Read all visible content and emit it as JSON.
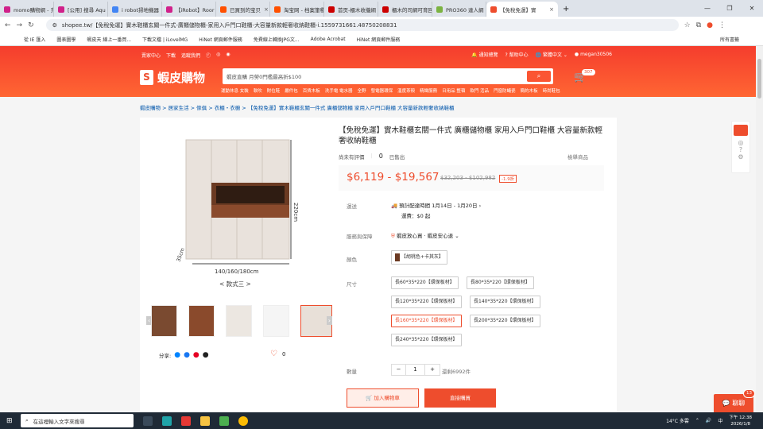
{
  "tabs": [
    {
      "label": "momo購物網 - 充",
      "color": "#d0218a"
    },
    {
      "label": "[公用] 搜尋 Aqu",
      "color": "#d0218a"
    },
    {
      "label": "i robot掃地機器",
      "color": "#4285f4"
    },
    {
      "label": "【iRobot】Roor",
      "color": "#d0218a"
    },
    {
      "label": "已買到的宝贝",
      "color": "#ff5000"
    },
    {
      "label": "淘宝网 - 档案筆種",
      "color": "#ff5000"
    },
    {
      "label": "首页-櫃木收攏網",
      "color": "#c00"
    },
    {
      "label": "櫃木的司網可育回",
      "color": "#c00"
    },
    {
      "label": "PRO360 達人網",
      "color": "#7cb342"
    }
  ],
  "active_tab": "【免稅免運】實",
  "window_controls": [
    "—",
    "❐",
    "✕"
  ],
  "url": "shopee.tw/【免稅免運】實木鞋櫃玄關一件式-廣櫃儲物櫃-家用入戶門口鞋櫃-大容量新款輕奢收納鞋櫃-i.1559731661.48750208831",
  "bookmarks": [
    "從 IE 匯入",
    "圖表圖學",
    "蝦皮天 線上一番買...",
    "下載文檔 | iLovelMG",
    "HiNet 網頁郵件服務",
    "免費線上轉換JPG文...",
    "Adobe Acrobat",
    "HiNet 網頁郵件服務"
  ],
  "bookmarks_all": "所有書籤",
  "shopee": {
    "toplinks": [
      "賣家中心",
      "下載",
      "追蹤我們"
    ],
    "notify": "通知總覽",
    "help": "幫助中心",
    "lang": "繁體中文",
    "user": "megan30506",
    "logo": "蝦皮購物",
    "search_placeholder": "蝦皮直購 月勞0門檻最高折$100",
    "cats": [
      "運動休息 女裝",
      "軟吹",
      "財位鞋",
      "嚴件包",
      "百貨木板",
      "洗手電 電水器",
      "全野",
      "發電器環保",
      "溫度茶殼",
      "精緻服務",
      "日用品 整頓",
      "軟門 活品",
      "門窗防蠅瓷",
      "簡約木板",
      "時尚鞋包"
    ],
    "cart_count": "307"
  },
  "breadcrumb": "蝦皮購物 > 居家生活 > 傢俱 > 衣櫃・衣櫥 > 【免稅免運】實木鞋櫃玄關一件式 廣櫃儲物櫃 家用入戶門口鞋櫃 大容量新款輕奢收納鞋櫃",
  "image": {
    "height_label": "220cm",
    "depth_label": "35cm",
    "width_label": "140/160/180cm",
    "caption": "< 款式三 >"
  },
  "share": {
    "label": "分享:",
    "likes": "0"
  },
  "product": {
    "title": "【免稅免運】實木鞋櫃玄關一件式 廣櫃儲物櫃 家用入戶門口鞋櫃 大容量新款輕奢收納鞋櫃",
    "rating": "尚未有評價",
    "sold_count": "0",
    "sold_label": "已售出",
    "report": "檢舉商品",
    "price": "$6,119 - $19,567",
    "old_price": "$32,203 - $102,982",
    "discount": "-1.9折"
  },
  "shipping": {
    "label": "運送",
    "eta": "預計配達時間 1月14日 - 1月20日",
    "fee": "運費：$0 起"
  },
  "guarantee": {
    "label": "服務與保障",
    "value": "蝦皮放心買 · 蝦皮安心退"
  },
  "color": {
    "label": "顏色",
    "value": "【胡桃色+卡其灰】"
  },
  "size": {
    "label": "尺寸",
    "options": [
      "長60*35*220【環保板材】",
      "長80*35*220【環保板材】",
      "長120*35*220【環保板材】",
      "長140*35*220【環保板材】",
      "長160*35*220【環保板材】",
      "長200*35*220【環保板材】",
      "長240*35*220【環保板材】"
    ],
    "selected": "長160*35*220【環保板材】"
  },
  "quantity": {
    "label": "數量",
    "value": "1",
    "stock": "還剩6992件"
  },
  "buttons": {
    "add_to_cart": "加入購物車",
    "buy_now": "直接購買"
  },
  "chat": {
    "label": "聊聊",
    "badge": "13"
  },
  "taskbar": {
    "search": "在這裡輸入文字來搜尋",
    "weather": "14°C 多雲",
    "ime": "中",
    "time": "下午 12:38",
    "date": "2026/1/8"
  },
  "colors": {
    "brand": "#ee4d2d"
  }
}
